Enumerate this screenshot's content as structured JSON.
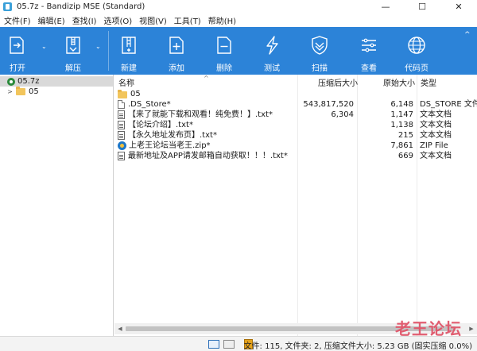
{
  "window": {
    "title": "05.7z - Bandizip MSE (Standard)",
    "app_icon": "bandizip-icon",
    "controls": {
      "minimize": "—",
      "maximize": "☐",
      "close": "✕"
    }
  },
  "menu": [
    {
      "label": "文件(F)"
    },
    {
      "label": "编辑(E)"
    },
    {
      "label": "查找(I)"
    },
    {
      "label": "选项(O)"
    },
    {
      "label": "视图(V)"
    },
    {
      "label": "工具(T)"
    },
    {
      "label": "帮助(H)"
    }
  ],
  "toolbar": {
    "background": "#2c83d8",
    "buttons": [
      {
        "label": "打开",
        "icon": "open-icon"
      },
      {
        "label": "解压",
        "icon": "extract-icon"
      },
      {
        "label": "新建",
        "icon": "new-archive-icon"
      },
      {
        "label": "添加",
        "icon": "add-file-icon"
      },
      {
        "label": "删除",
        "icon": "delete-file-icon"
      },
      {
        "label": "测试",
        "icon": "test-lightning-icon"
      },
      {
        "label": "扫描",
        "icon": "scan-shield-icon"
      },
      {
        "label": "查看",
        "icon": "view-list-icon"
      },
      {
        "label": "代码页",
        "icon": "codepage-globe-icon"
      }
    ],
    "collapse_arrow": "^"
  },
  "tree": {
    "items": [
      {
        "label": "05.7z",
        "type": "archive",
        "expanded": true,
        "selected": true
      },
      {
        "label": "05",
        "type": "folder",
        "expanded": false,
        "selected": false
      }
    ]
  },
  "list": {
    "columns": {
      "name": "名称",
      "packed": "压缩后大小",
      "original": "原始大小",
      "type": "类型"
    },
    "rows": [
      {
        "name": "05",
        "packed": "",
        "original": "",
        "type": "",
        "icon": "folder-icon"
      },
      {
        "name": ".DS_Store*",
        "packed": "543,817,520",
        "original": "6,148",
        "type": "DS_STORE 文件",
        "icon": "file-icon"
      },
      {
        "name": "【来了就能下载和观看！纯免费！】.txt*",
        "packed": "6,304",
        "original": "1,147",
        "type": "文本文档",
        "icon": "text-file-icon"
      },
      {
        "name": "【论坛介绍】.txt*",
        "packed": "",
        "original": "1,138",
        "type": "文本文档",
        "icon": "text-file-icon"
      },
      {
        "name": "【永久地址发布页】.txt*",
        "packed": "",
        "original": "215",
        "type": "文本文档",
        "icon": "text-file-icon"
      },
      {
        "name": "上老王论坛当老王.zip*",
        "packed": "",
        "original": "7,861",
        "type": "ZIP File",
        "icon": "zip-file-icon"
      },
      {
        "name": "最新地址及APP请发邮箱自动获取！！！.txt*",
        "packed": "",
        "original": "669",
        "type": "文本文档",
        "icon": "text-file-icon"
      }
    ]
  },
  "status": {
    "text": "文件: 115, 文件夹: 2, 压缩文件大小: 5.23 GB (固实压缩 0.0%)"
  },
  "watermark": {
    "text": "老王论坛",
    "color": "#e0566a"
  }
}
